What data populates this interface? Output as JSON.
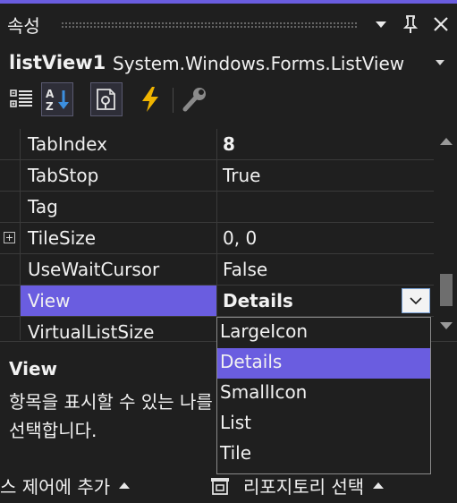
{
  "panel": {
    "title": "속성",
    "object_name": "listView1",
    "object_type": "System.Windows.Forms.ListView"
  },
  "toolbar": {
    "icons": [
      "categorized-icon",
      "alphabetical-icon",
      "properties-icon",
      "events-icon",
      "property-pages-icon"
    ],
    "active": [
      "alphabetical-icon",
      "properties-icon"
    ]
  },
  "properties": [
    {
      "name": "TabIndex",
      "value": "8",
      "bold": true
    },
    {
      "name": "TabStop",
      "value": "True"
    },
    {
      "name": "Tag",
      "value": ""
    },
    {
      "name": "TileSize",
      "value": "0, 0",
      "expandable": true
    },
    {
      "name": "UseWaitCursor",
      "value": "False"
    },
    {
      "name": "View",
      "value": "Details",
      "bold": true,
      "selected": true
    },
    {
      "name": "VirtualListSize",
      "value": ""
    }
  ],
  "dropdown": {
    "options": [
      "LargeIcon",
      "Details",
      "SmallIcon",
      "List",
      "Tile"
    ],
    "selected": "Details"
  },
  "description": {
    "title": "View",
    "text": "항목을 표시할 수 있는 나를 선택합니다."
  },
  "bottom_tabs": {
    "left_label": "스 제어에 추가",
    "right_label": "리포지토리 선택"
  },
  "colors": {
    "accent": "#6a5de0",
    "background": "#1f1f1f",
    "text": "#f1f1f1"
  }
}
